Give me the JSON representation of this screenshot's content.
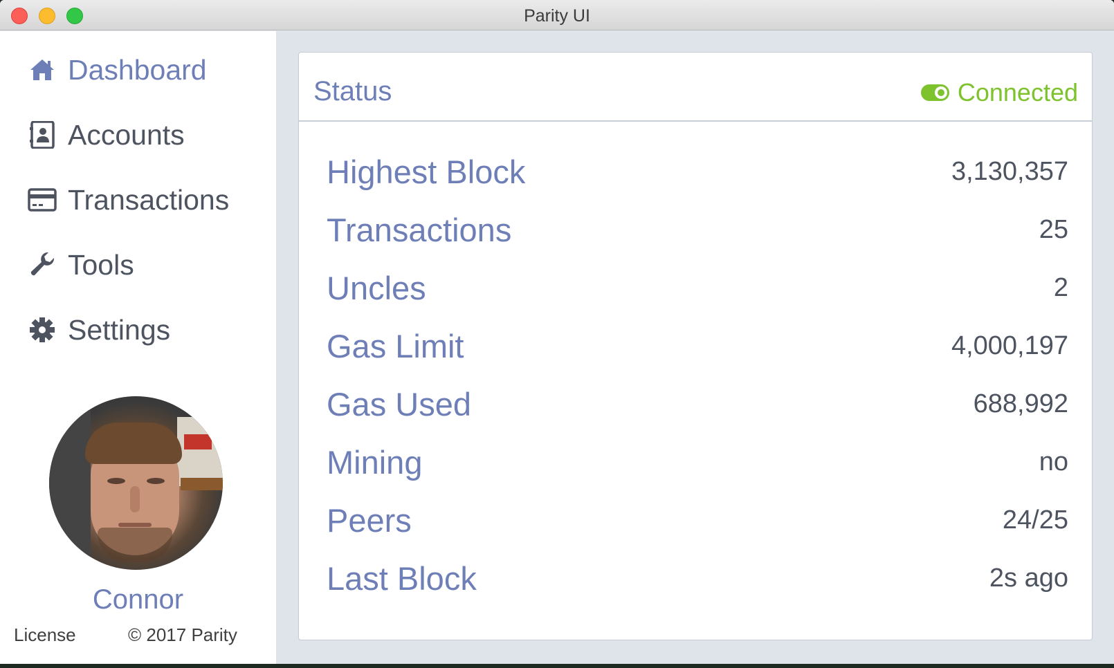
{
  "window": {
    "title": "Parity UI"
  },
  "sidebar": {
    "items": [
      {
        "label": "Dashboard",
        "icon": "home-icon",
        "active": true
      },
      {
        "label": "Accounts",
        "icon": "address-book-icon",
        "active": false
      },
      {
        "label": "Transactions",
        "icon": "credit-card-icon",
        "active": false
      },
      {
        "label": "Tools",
        "icon": "wrench-icon",
        "active": false
      },
      {
        "label": "Settings",
        "icon": "gear-icon",
        "active": false
      }
    ],
    "user": {
      "name": "Connor"
    },
    "footer": {
      "license": "License",
      "copyright": "© 2017 Parity"
    }
  },
  "status": {
    "title": "Status",
    "connection": {
      "label": "Connected",
      "color": "#7ec22e"
    },
    "rows": [
      {
        "label": "Highest Block",
        "value": "3,130,357"
      },
      {
        "label": "Transactions",
        "value": "25"
      },
      {
        "label": "Uncles",
        "value": "2"
      },
      {
        "label": "Gas Limit",
        "value": "4,000,197"
      },
      {
        "label": "Gas Used",
        "value": "688,992"
      },
      {
        "label": "Mining",
        "value": "no"
      },
      {
        "label": "Peers",
        "value": "24/25"
      },
      {
        "label": "Last Block",
        "value": "2s ago"
      }
    ]
  },
  "colors": {
    "accent": "#6e7fb8",
    "text": "#4d5460",
    "connected": "#7ec22e"
  }
}
